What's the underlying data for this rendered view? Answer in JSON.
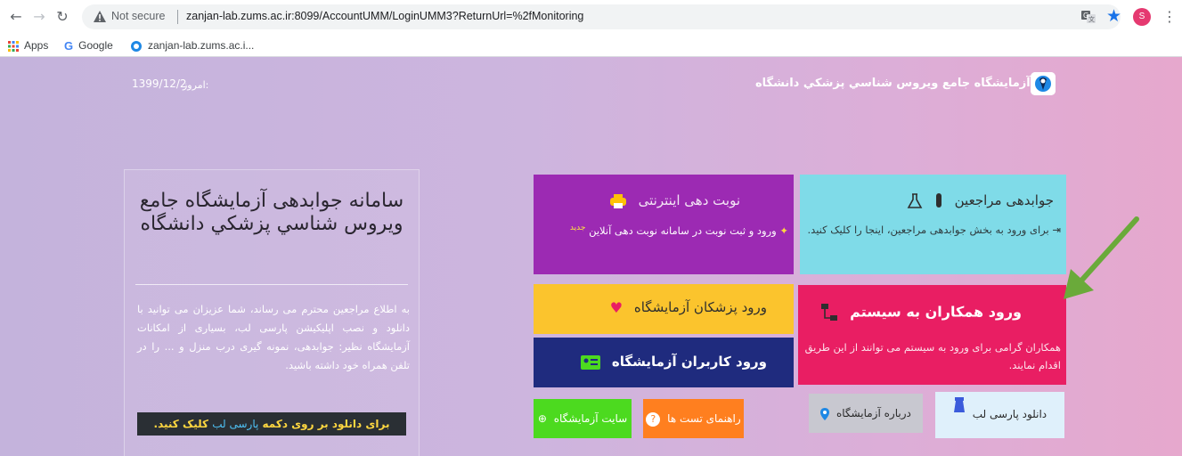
{
  "browser": {
    "not_secure": "Not secure",
    "url": "zanjan-lab.zums.ac.ir:8099/AccountUMM/LoginUMM3?ReturnUrl=%2fMonitoring",
    "profile_initial": "S",
    "bookmarks": [
      "Apps",
      "Google",
      "zanjan-lab.zums.ac.i..."
    ]
  },
  "header": {
    "date_label": "امروز:",
    "date_value": "1399/12/2",
    "site_title": "آزمايشگاه جامع ويروس شناسي پزشكي دانشگاه"
  },
  "info": {
    "title": "سامانه جوابدهی آزمايشگاه جامع ويروس شناسي پزشكي دانشگاه",
    "text": "به اطلاع مراجعين محترم می رساند، شما عزيزان می توانيد با دانلود و نصب اپليكيشن پارسی لب، بسياری از امكانات آزمايشگاه نظير: جوابدهی، نمونه گيری درب منزل و ... را در تلفن همراه خود داشته باشيد.",
    "download_pre": "برای دانلود بر روی دكمه",
    "download_link": "پارسی لب",
    "download_post": "كليک كنيد."
  },
  "tiles": {
    "patients": {
      "title": "جوابدهی مراجعين",
      "desc": "برای ورود به بخش جوابدهی مراجعين، اينجا را كليک كنيد."
    },
    "booking": {
      "title": "نوبت دهی اينترنتی",
      "desc": "ورود و ثبت نوبت در سامانه نوبت دهی آنلاين",
      "badge": "جديد"
    },
    "doctors": {
      "title": "ورود پزشكان آزمايشگاه"
    },
    "users": {
      "title": "ورود كاربران آزمايشگاه"
    },
    "staff": {
      "title": "ورود همكاران به سيستم",
      "desc": "همكاران گرامی برای ورود به سيستم می توانند از اين طريق اقدام نمايند."
    }
  },
  "buttons": {
    "site": "سايت آزمايشگاه",
    "guide": "راهنمای تست ها",
    "about": "درباره آزمايشگاه",
    "download": "دانلود پارسی لب"
  },
  "colors": {
    "cyan": "#7fdbe8",
    "purple": "#9c2ab3",
    "yellow": "#fbc42d",
    "navy": "#1f2b7e",
    "pink": "#e91e63",
    "green": "#4cda1f",
    "orange": "#ff7f1f"
  }
}
